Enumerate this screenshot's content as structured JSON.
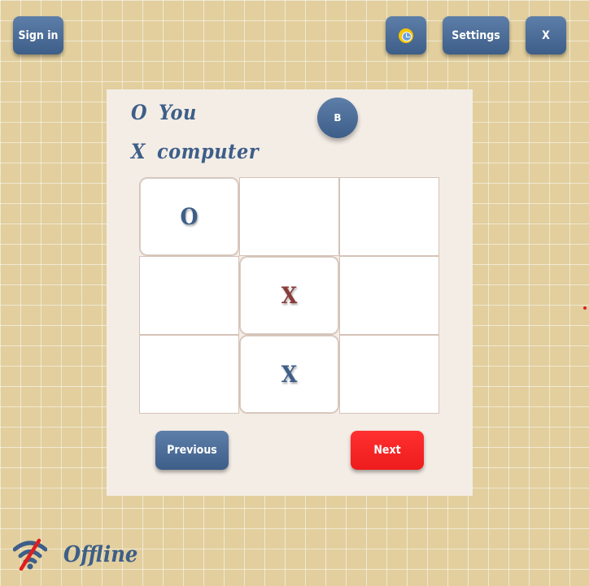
{
  "toolbar": {
    "signin_label": "Sign in",
    "stats_icon": "clock-icon",
    "settings_label": "Settings",
    "close_label": "X"
  },
  "players": {
    "you_symbol": "O",
    "you_label": "You",
    "computer_symbol": "X",
    "computer_label": "computer"
  },
  "round_badge": "B",
  "board": {
    "cells": [
      "O",
      "",
      "",
      "",
      "X",
      "",
      "",
      "X",
      ""
    ]
  },
  "nav": {
    "previous_label": "Previous",
    "next_label": "Next"
  },
  "status": {
    "icon": "wifi-off-icon",
    "text": "Offline"
  },
  "colors": {
    "primary": "#3d5e88",
    "accent": "#ee1c1c",
    "x_latest": "#8b3a3a",
    "panel": "#f4ede6",
    "background": "#e2cf9d"
  }
}
